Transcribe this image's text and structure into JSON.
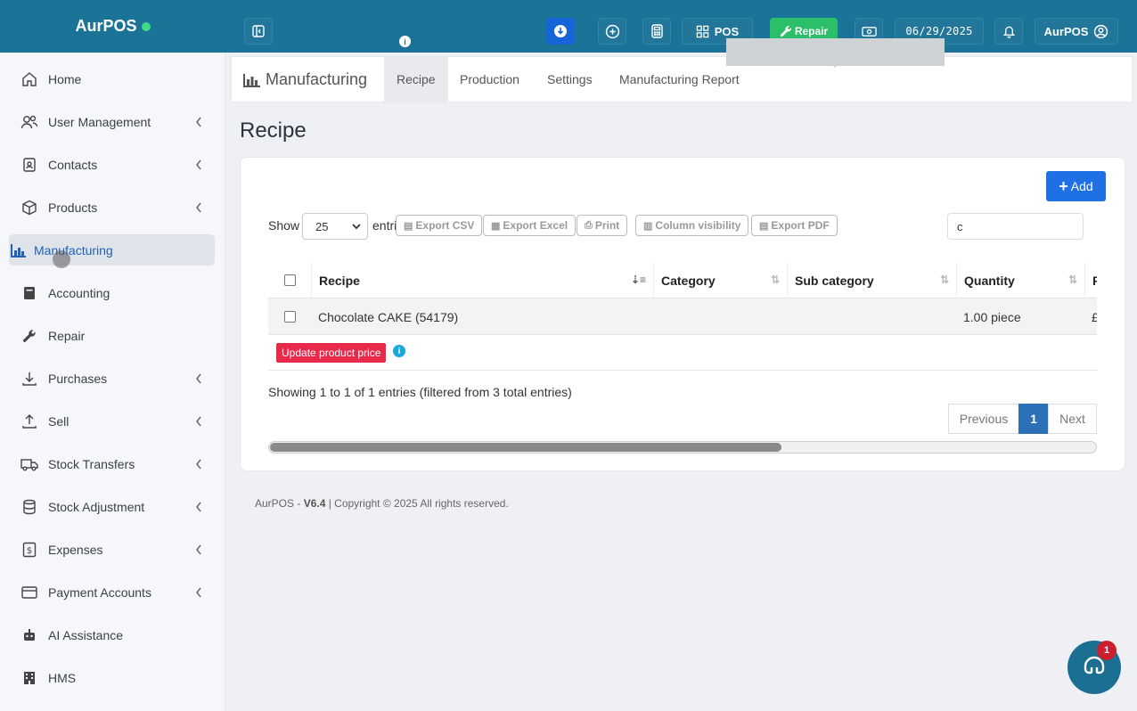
{
  "topbar": {
    "brand": "AurPOS",
    "pos_label": "POS",
    "repair_label": "Repair",
    "date": "06/29/2025",
    "user_label": "AurPOS",
    "info_glyph": "i"
  },
  "sidebar": {
    "items": [
      {
        "label": "Home",
        "icon": "home-icon"
      },
      {
        "label": "User Management",
        "icon": "users-icon",
        "chevron": true
      },
      {
        "label": "Contacts",
        "icon": "contacts-icon",
        "chevron": true
      },
      {
        "label": "Products",
        "icon": "box-icon",
        "chevron": true
      },
      {
        "label": "Manufacturing",
        "icon": "chart-icon",
        "active": true
      },
      {
        "label": "Accounting",
        "icon": "book-icon"
      },
      {
        "label": "Repair",
        "icon": "wrench-icon"
      },
      {
        "label": "Purchases",
        "icon": "download-icon",
        "chevron": true
      },
      {
        "label": "Sell",
        "icon": "upload-icon",
        "chevron": true
      },
      {
        "label": "Stock Transfers",
        "icon": "truck-icon",
        "chevron": true
      },
      {
        "label": "Stock Adjustment",
        "icon": "database-icon",
        "chevron": true
      },
      {
        "label": "Expenses",
        "icon": "dollar-icon",
        "chevron": true
      },
      {
        "label": "Payment Accounts",
        "icon": "card-icon",
        "chevron": true
      },
      {
        "label": "AI Assistance",
        "icon": "robot-icon"
      },
      {
        "label": "HMS",
        "icon": "building-icon"
      }
    ]
  },
  "subnav": {
    "title": "Manufacturing",
    "tabs": [
      "Recipe",
      "Production",
      "Settings",
      "Manufacturing Report"
    ]
  },
  "page": {
    "title": "Recipe",
    "add_label": "Add",
    "show_label": "Show",
    "entries_label": "entries",
    "page_size": "25",
    "export_buttons": [
      "Export CSV",
      "Export Excel",
      "Print",
      "Column visibility",
      "Export PDF"
    ],
    "search_value": "c",
    "columns": [
      "Recipe",
      "Category",
      "Sub category",
      "Quantity",
      "F"
    ],
    "rows": [
      {
        "recipe": "Chocolate CAKE (54179)",
        "category": "",
        "sub_category": "",
        "quantity": "1.00 piece",
        "extra": "£"
      }
    ],
    "update_price_label": "Update product price",
    "info_glyph": "i",
    "showing_text": "Showing 1 to 1 of 1 entries (filtered from 3 total entries)",
    "pagination": {
      "previous": "Previous",
      "current": "1",
      "next": "Next"
    },
    "scroll_fraction": 0.62
  },
  "footer": {
    "brand": "AurPOS - ",
    "version": "V6.4",
    "copyright": " | Copyright © 2025 All rights reserved."
  },
  "chat": {
    "badge": "1"
  },
  "colors": {
    "topbar": "#1b7497",
    "accent": "#1f6fe5",
    "repair": "#2bbf6a",
    "danger": "#e8294a"
  }
}
